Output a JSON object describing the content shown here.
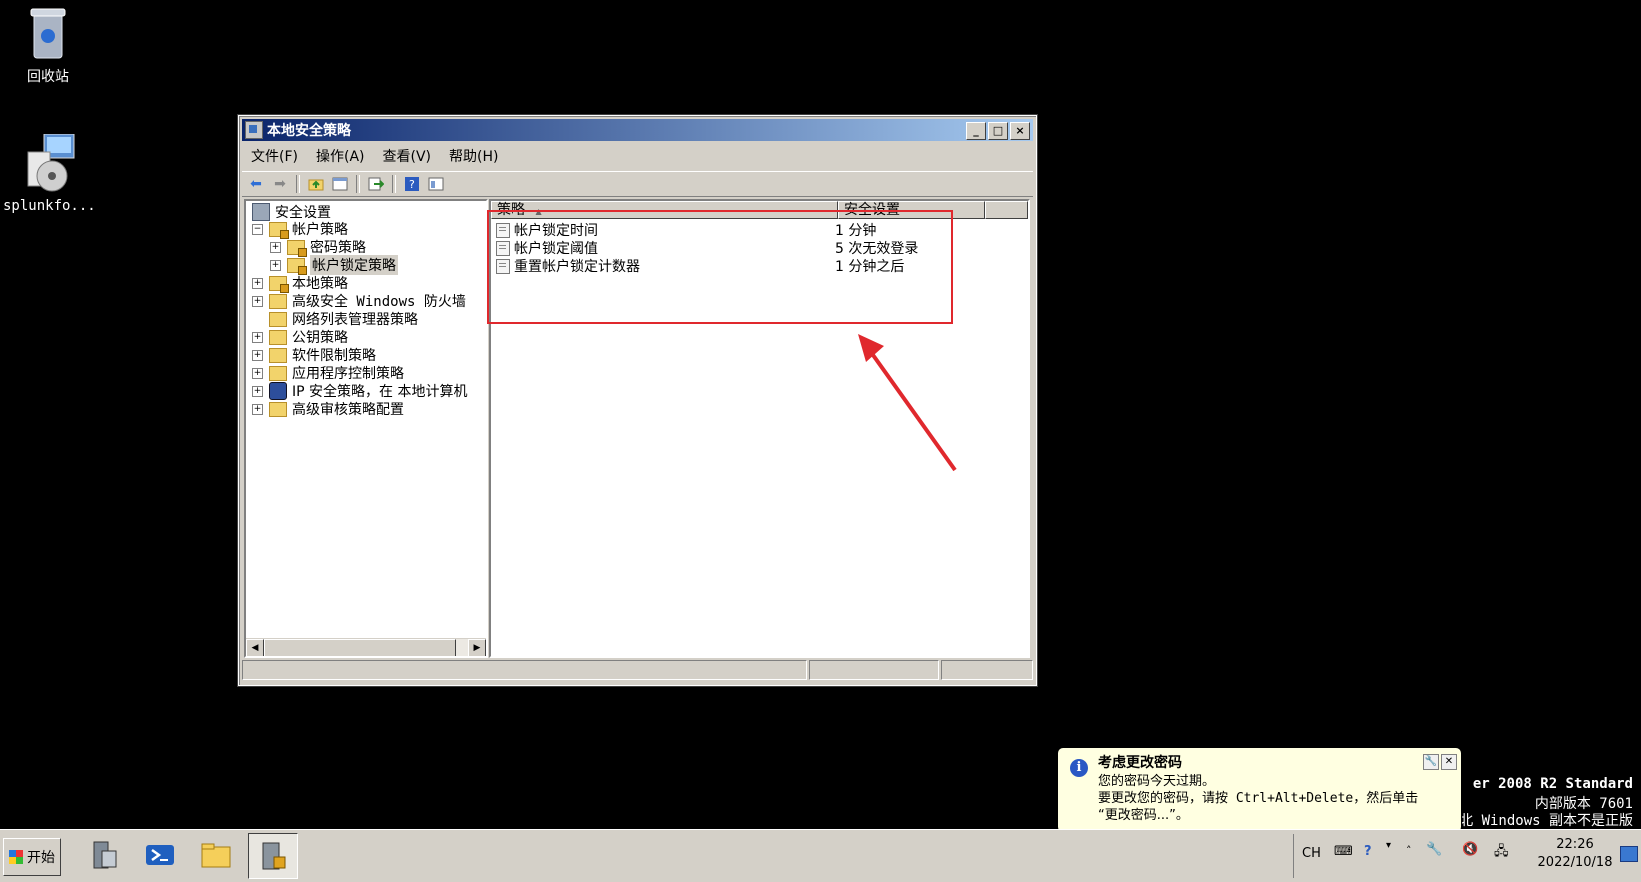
{
  "desktop": {
    "icons": [
      {
        "label": "回收站"
      },
      {
        "label": "splunkfo..."
      }
    ],
    "watermark": {
      "line1": "er 2008 R2 Standard",
      "line2": "内部版本 7601",
      "line3": "北 Windows 副本不是正版"
    }
  },
  "window": {
    "title": "本地安全策略",
    "buttons": {
      "minimize": "_",
      "maximize": "□",
      "close": "×"
    },
    "menu": [
      "文件(F)",
      "操作(A)",
      "查看(V)",
      "帮助(H)"
    ],
    "tree": {
      "root": "安全设置",
      "items": [
        {
          "label": "帐户策略",
          "expander": "−"
        },
        {
          "label": "密码策略",
          "expander": "+"
        },
        {
          "label": "帐户锁定策略",
          "expander": "+"
        },
        {
          "label": "本地策略",
          "expander": "+"
        },
        {
          "label": "高级安全 Windows 防火墙",
          "expander": "+"
        },
        {
          "label": "网络列表管理器策略",
          "expander": ""
        },
        {
          "label": "公钥策略",
          "expander": "+"
        },
        {
          "label": "软件限制策略",
          "expander": "+"
        },
        {
          "label": "应用程序控制策略",
          "expander": "+"
        },
        {
          "label": "IP 安全策略，在 本地计算机",
          "expander": "+"
        },
        {
          "label": "高级审核策略配置",
          "expander": "+"
        }
      ],
      "scroll_left": "◀",
      "scroll_right": "▶"
    },
    "list": {
      "columns": [
        "策略",
        "安全设置"
      ],
      "sort_indicator": "▲",
      "rows": [
        {
          "policy": "帐户锁定时间",
          "setting": "1 分钟"
        },
        {
          "policy": "帐户锁定阈值",
          "setting": "5 次无效登录"
        },
        {
          "policy": "重置帐户锁定计数器",
          "setting": "1 分钟之后"
        }
      ]
    }
  },
  "taskbar": {
    "start_label": "开始",
    "apps": [
      "server-manager",
      "powershell",
      "explorer",
      "local-security-policy"
    ],
    "tray": {
      "lang": "CH"
    },
    "clock": {
      "time": "22:26",
      "date": "2022/10/18"
    }
  },
  "balloon": {
    "title": "考虑更改密码",
    "line1": "您的密码今天过期。",
    "line2": "要更改您的密码，请按 Ctrl+Alt+Delete，然后单击",
    "line3": "“更改密码...”。"
  },
  "colors": {
    "annotation": "#e0282d",
    "title_start": "#0a246a",
    "title_end": "#a6caf0"
  }
}
